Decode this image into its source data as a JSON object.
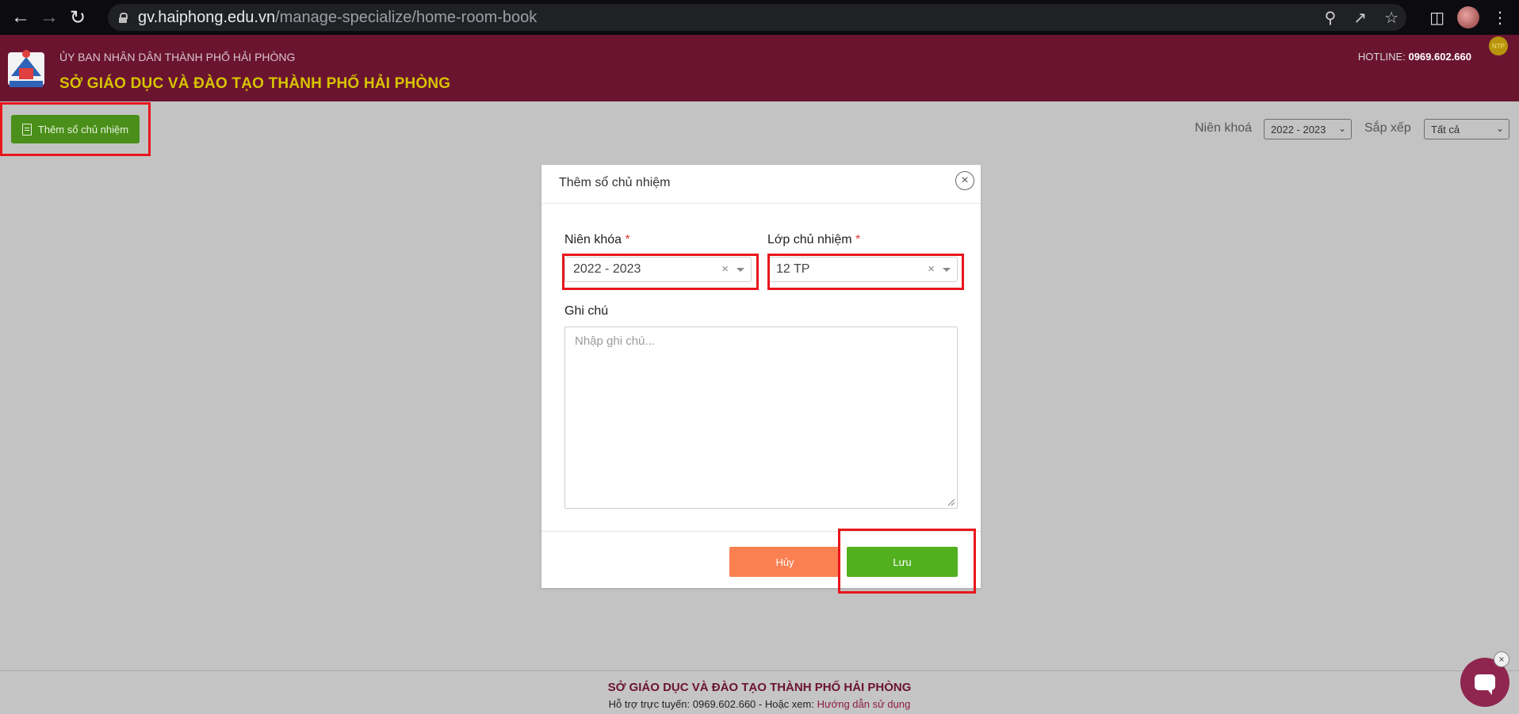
{
  "browser": {
    "url_domain": "gv.haiphong.edu.vn",
    "url_path": "/manage-specialize/home-room-book"
  },
  "header": {
    "org_top": "ỦY BAN NHÂN DÂN THÀNH PHỐ HẢI PHÒNG",
    "org_main": "SỞ GIÁO DỤC VÀ ĐÀO TẠO THÀNH PHỐ HẢI PHÒNG",
    "hotline_label": "HOTLINE:",
    "hotline_number": "0969.602.660",
    "user_badge": "NTP"
  },
  "toolbar": {
    "add_button_label": "Thêm sổ chủ nhiệm",
    "year_filter_label": "Niên khoá",
    "year_filter_value": "2022 - 2023",
    "sort_label": "Sắp xếp",
    "sort_value": "Tất cả"
  },
  "modal": {
    "title": "Thêm sổ chủ nhiệm",
    "year_label": "Niên khóa",
    "year_value": "2022 - 2023",
    "class_label": "Lớp chủ nhiệm",
    "class_value": "12 TP",
    "required_mark": "*",
    "note_label": "Ghi chú",
    "note_placeholder": "Nhập ghi chú...",
    "cancel_label": "Hủy",
    "save_label": "Lưu"
  },
  "footer": {
    "title": "SỞ GIÁO DỤC VÀ ĐÀO TẠO THÀNH PHỐ HẢI PHÒNG",
    "support_text": "Hỗ trợ trực tuyến: 0969.602.660 - Hoặc xem:",
    "guide_link": "Hướng dẫn sử dụng"
  },
  "colors": {
    "header_bg": "#6b1430",
    "header_title": "#d6c300",
    "primary_green": "#52b01f",
    "cancel_orange": "#fa8052",
    "highlight_red": "#e8161c"
  }
}
